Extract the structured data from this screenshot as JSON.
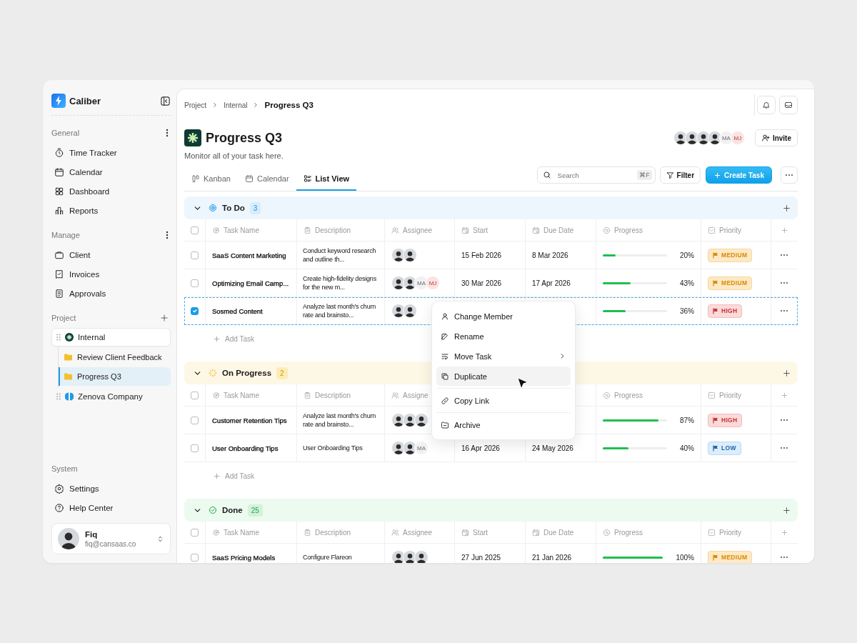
{
  "sidebar": {
    "brand": "Caliber",
    "sections": [
      {
        "title": "General",
        "items": [
          {
            "label": "Time Tracker"
          },
          {
            "label": "Calendar"
          },
          {
            "label": "Dashboard"
          },
          {
            "label": "Reports"
          }
        ]
      },
      {
        "title": "Manage",
        "items": [
          {
            "label": "Client"
          },
          {
            "label": "Invoices"
          },
          {
            "label": "Approvals"
          }
        ]
      }
    ],
    "projects": {
      "title": "Project",
      "items": [
        {
          "label": "Internal",
          "kind": "internal",
          "expanded": true,
          "children": [
            {
              "label": "Review Client Feedback",
              "selected": false
            },
            {
              "label": "Progress Q3",
              "selected": true
            }
          ]
        },
        {
          "label": "Zenova Company",
          "kind": "zenova",
          "expanded": false
        }
      ]
    },
    "system": {
      "title": "System",
      "items": [
        {
          "label": "Settings"
        },
        {
          "label": "Help Center"
        }
      ]
    },
    "user": {
      "name": "Fiq",
      "email": "fiq@cansaas.co"
    }
  },
  "breadcrumb": [
    "Project",
    "Internal",
    "Progress Q3"
  ],
  "page": {
    "title": "Progress Q3",
    "subtitle": "Monitor all of your task here.",
    "members": [
      {
        "kind": "photo"
      },
      {
        "kind": "photo"
      },
      {
        "kind": "photo"
      },
      {
        "kind": "photo"
      },
      {
        "kind": "initials",
        "initials": "MA",
        "accent": false
      },
      {
        "kind": "initials",
        "initials": "MJ",
        "accent": true
      }
    ],
    "invite": "Invite"
  },
  "tabs": [
    {
      "label": "Kanban",
      "selected": false
    },
    {
      "label": "Calendar",
      "selected": false
    },
    {
      "label": "List View",
      "selected": true
    }
  ],
  "search": {
    "placeholder": "Search",
    "shortcut": "⌘F"
  },
  "filter": "Filter",
  "create": "Create Task",
  "groups": [
    {
      "kind": "todo",
      "title": "To Do",
      "count": "3",
      "expanded": true,
      "all_checked": false,
      "add_task": "Add Task",
      "columns": [
        "Task Name",
        "Description",
        "Assignee",
        "Start",
        "Due Date",
        "Progress",
        "Priority"
      ],
      "tasks": [
        {
          "name": "SaaS Content Marketing",
          "description": "Conduct keyword research and outline th...",
          "assignees": [
            {
              "kind": "photo"
            },
            {
              "kind": "photo"
            }
          ],
          "start": "15 Feb 2026",
          "due": "8 Mar 2026",
          "level": 0.2,
          "reading": "20%",
          "priority": {
            "kind": "medium",
            "label": "MEDIUM"
          },
          "checked": false,
          "selected": false
        },
        {
          "name": "Optimizing Email Camp...",
          "description": "Create high-fidelity designs for the new m...",
          "assignees": [
            {
              "kind": "photo"
            },
            {
              "kind": "photo"
            },
            {
              "kind": "initials",
              "initials": "MA",
              "accent": false
            },
            {
              "kind": "initials",
              "initials": "MJ",
              "accent": true
            }
          ],
          "start": "30 Mar 2026",
          "due": "17 Apr 2026",
          "level": 0.43,
          "reading": "43%",
          "priority": {
            "kind": "medium",
            "label": "MEDIUM"
          },
          "checked": false,
          "selected": false
        },
        {
          "name": "Sosmed Content",
          "description": "Analyze last month's churn rate and brainsto...",
          "assignees": [
            {
              "kind": "photo"
            },
            {
              "kind": "photo"
            }
          ],
          "level": 0.36,
          "reading": "36%",
          "priority": {
            "kind": "high",
            "label": "HIGH"
          },
          "checked": true,
          "selected": true
        }
      ]
    },
    {
      "kind": "progress",
      "title": "On Progress",
      "count": "2",
      "expanded": true,
      "all_checked": false,
      "add_task": "Add Task",
      "columns": [
        "Task Name",
        "Description",
        "Assigne",
        null,
        null,
        "Progress",
        "Priority"
      ],
      "tasks": [
        {
          "name": "Customer Retention Tips",
          "description": "Analyze last month's churn rate and brainsto...",
          "assignees": [
            {
              "kind": "photo"
            },
            {
              "kind": "photo"
            },
            {
              "kind": "photo"
            }
          ],
          "level": 0.87,
          "reading": "87%",
          "priority": {
            "kind": "high",
            "label": "HIGH"
          },
          "checked": false,
          "selected": false
        },
        {
          "name": "User Onboarding Tips",
          "description": "User Onboarding Tips",
          "assignees": [
            {
              "kind": "photo"
            },
            {
              "kind": "photo"
            },
            {
              "kind": "initials",
              "initials": "MA",
              "accent": false
            }
          ],
          "start": "16 Apr 2026",
          "due": "24 May 2026",
          "level": 0.4,
          "reading": "40%",
          "priority": {
            "kind": "low",
            "label": "LOW"
          },
          "checked": false,
          "selected": false
        }
      ]
    },
    {
      "kind": "done",
      "title": "Done",
      "count": "25",
      "expanded": true,
      "all_checked": false,
      "columns": [
        "Task Name",
        "Description",
        "Assignee",
        "Start",
        "Due Date",
        "Progress",
        "Priority"
      ],
      "tasks": [
        {
          "name": "SaaS Pricing Models",
          "description": "Configure Flareon",
          "assignees": [
            {
              "kind": "photo"
            },
            {
              "kind": "photo"
            },
            {
              "kind": "photo"
            }
          ],
          "start": "27 Jun 2025",
          "due": "21 Jan 2026",
          "level": 1.0,
          "reading": "100%",
          "priority": {
            "kind": "medium",
            "label": "MEDIUM"
          },
          "checked": false,
          "selected": false
        }
      ]
    }
  ],
  "context_menu": [
    {
      "label": "Change Member",
      "selected": false
    },
    {
      "label": "Rename",
      "selected": false
    },
    {
      "label": "Move Task",
      "selected": false,
      "submenu": true
    },
    {
      "label": "Duplicate",
      "selected": true
    },
    {
      "label": "Copy Link",
      "selected": false,
      "divider_before": true
    },
    {
      "label": "Archive",
      "selected": false,
      "divider_before": true
    }
  ]
}
